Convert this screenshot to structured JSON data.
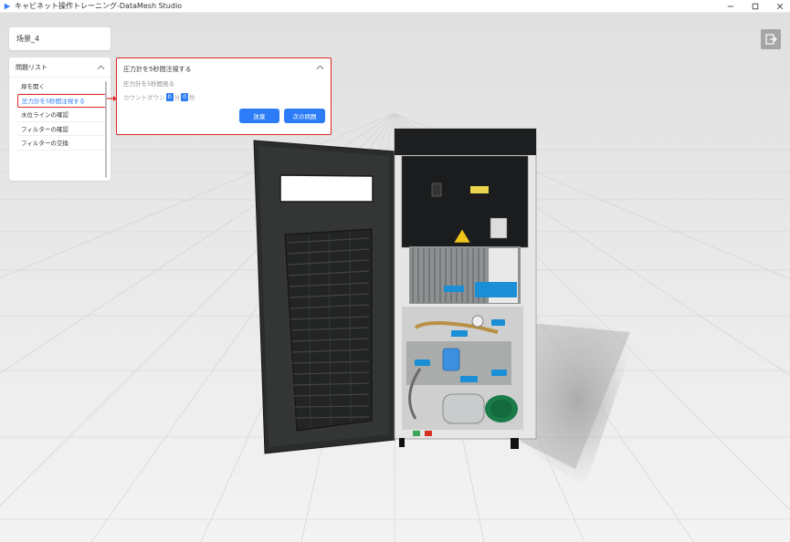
{
  "window": {
    "title": "キャビネット操作トレーニング-DataMesh Studio",
    "controls": [
      "minimize-icon",
      "maximize-icon",
      "close-icon"
    ]
  },
  "scene": {
    "name": "场景_4"
  },
  "problem_list": {
    "title": "問題リスト",
    "items": [
      {
        "label": "扉を開く",
        "active": false
      },
      {
        "label": "圧力計を5秒間注視する",
        "active": true
      },
      {
        "label": "水位ラインの確認",
        "active": false
      },
      {
        "label": "フィルターの確認",
        "active": false
      },
      {
        "label": "フィルターの交換",
        "active": false
      }
    ]
  },
  "task": {
    "title": "圧力計を5秒間注視する",
    "description": "圧力計を5秒間見る",
    "countdown_label": "カウントダウン",
    "countdown_first": "0",
    "countdown_sep": "分",
    "countdown_second": "0",
    "countdown_unit": "秒",
    "giveup_label": "放棄",
    "next_label": "次の問題"
  },
  "exit": {
    "icon": "exit-icon"
  },
  "colors": {
    "accent": "#2b7cf6",
    "highlight_border": "#e02424",
    "callout": "#1a8fd6"
  }
}
